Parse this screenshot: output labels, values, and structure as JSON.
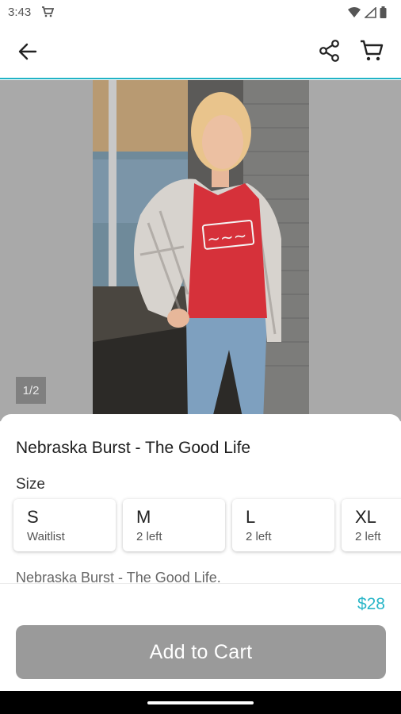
{
  "status_bar": {
    "time": "3:43",
    "icons": [
      "cart-notification-icon",
      "wifi-icon",
      "cell-signal-icon",
      "battery-icon"
    ]
  },
  "app_bar": {
    "back_icon": "arrow-left-icon",
    "share_icon": "share-icon",
    "cart_icon": "cart-icon",
    "accent_color": "#21b3c6"
  },
  "gallery": {
    "counter": "1/2"
  },
  "product": {
    "title": "Nebraska Burst - The Good Life",
    "size_label": "Size",
    "sizes": [
      {
        "name": "S",
        "stock": "Waitlist"
      },
      {
        "name": "M",
        "stock": "2 left"
      },
      {
        "name": "L",
        "stock": "2 left"
      },
      {
        "name": "XL",
        "stock": "2 left"
      }
    ],
    "description": "Nebraska Burst - The Good Life."
  },
  "checkout": {
    "price": "$28",
    "price_color": "#29b6c8",
    "add_to_cart_label": "Add to Cart"
  }
}
